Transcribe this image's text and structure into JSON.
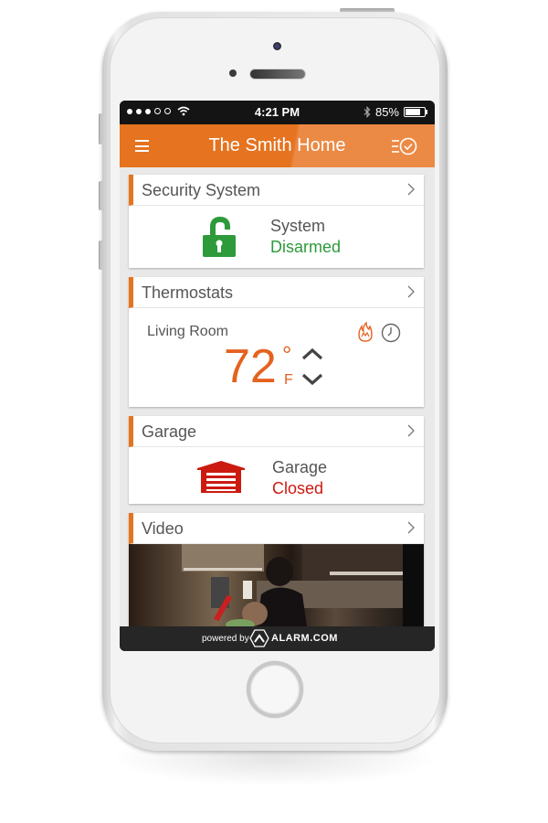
{
  "status_bar": {
    "signal_dots_filled": 3,
    "signal_dots_total": 5,
    "time": "4:21 PM",
    "battery": "85%",
    "battery_level": 0.85
  },
  "app_bar": {
    "title": "The Smith Home",
    "menu_icon": "hamburger-menu-icon",
    "schedule_icon": "list-clock-icon"
  },
  "cards": {
    "security": {
      "title": "Security System",
      "icon": "unlocked-padlock-icon",
      "label": "System",
      "state": "Disarmed",
      "state_color": "#2e9a3a"
    },
    "thermostats": {
      "title": "Thermostats",
      "room": "Living Room",
      "temperature": "72",
      "degree": "°",
      "unit": "F",
      "mode_icon": "flame-icon",
      "schedule_icon": "clock-icon"
    },
    "garage": {
      "title": "Garage",
      "icon": "garage-door-icon",
      "label": "Garage",
      "state": "Closed",
      "state_color": "#cc1a10"
    },
    "video": {
      "title": "Video"
    }
  },
  "footer": {
    "powered_by": "powered by",
    "brand": "ALARM.COM"
  },
  "colors": {
    "accent": "#e5731f",
    "temperature": "#e5621f"
  }
}
